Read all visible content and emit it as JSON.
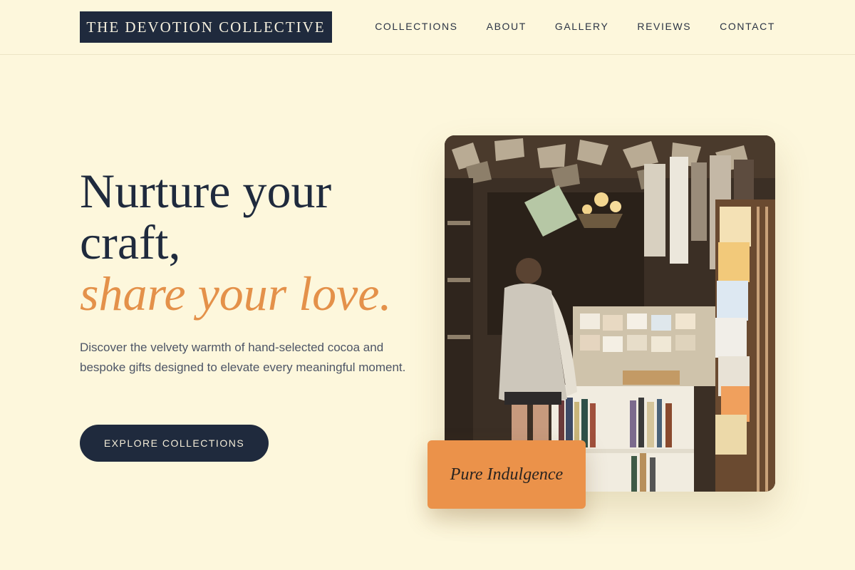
{
  "brand": {
    "name": "THE DEVOTION COLLECTIVE"
  },
  "nav": {
    "items": [
      "COLLECTIONS",
      "ABOUT",
      "GALLERY",
      "REVIEWS",
      "CONTACT"
    ]
  },
  "hero": {
    "headline_line1": "Nurture your craft,",
    "headline_accent": "share your love.",
    "lead": "Discover the velvety warmth of hand-selected cocoa and bespoke gifts designed to elevate every meaningful moment.",
    "cta_label": "EXPLORE COLLECTIONS"
  },
  "feature": {
    "image_subject": "shop-interior-photo",
    "badge_label": "Pure Indulgence"
  },
  "colors": {
    "background": "#fdf7dc",
    "navy": "#1f2a3d",
    "accent": "#e4914a",
    "badge": "#eb924a"
  }
}
